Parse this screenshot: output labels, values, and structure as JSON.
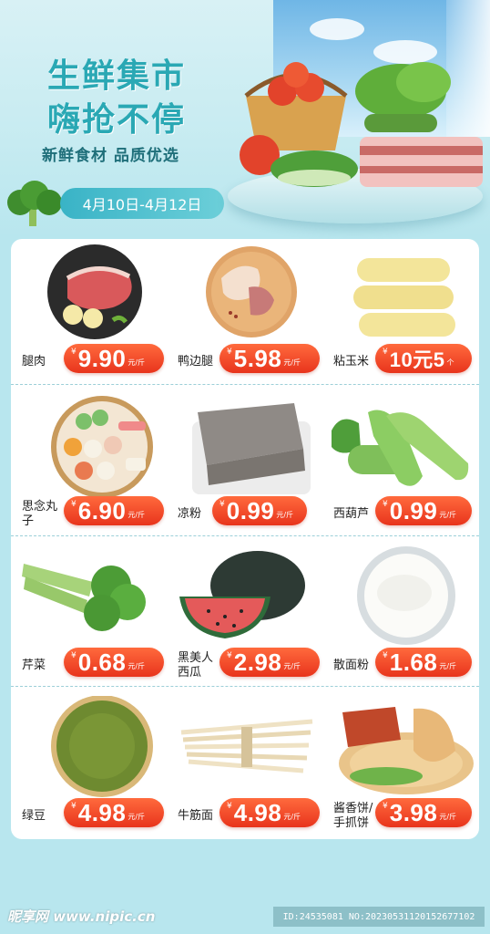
{
  "banner": {
    "title_line1": "生鲜集市",
    "title_line2": "嗨抢不停",
    "subtitle": "新鲜食材  品质优选",
    "date_range": "4月10日-4月12日"
  },
  "colors": {
    "title": "#2aa8b4",
    "price_pill": "#e8341c",
    "background": "#b8e6ee",
    "date_pill": "#39b3c6"
  },
  "products": [
    {
      "name": "腿肉",
      "yen": "¥",
      "price": "9.90",
      "unit": "元/斤",
      "icon": "pork-leg-icon"
    },
    {
      "name": "鸭边腿",
      "yen": "¥",
      "price": "5.98",
      "unit": "元/斤",
      "icon": "duck-leg-icon"
    },
    {
      "name": "粘玉米",
      "yen": "¥",
      "price": "10元5",
      "unit": "个",
      "icon": "corn-icon"
    },
    {
      "name": "思念丸子",
      "yen": "¥",
      "price": "6.90",
      "unit": "元/斤",
      "icon": "meatballs-icon"
    },
    {
      "name": "凉粉",
      "yen": "¥",
      "price": "0.99",
      "unit": "元/斤",
      "icon": "jelly-icon"
    },
    {
      "name": "西葫芦",
      "yen": "¥",
      "price": "0.99",
      "unit": "元/斤",
      "icon": "zucchini-icon"
    },
    {
      "name": "芹菜",
      "yen": "¥",
      "price": "0.68",
      "unit": "元/斤",
      "icon": "celery-icon"
    },
    {
      "name": "黑美人西瓜",
      "yen": "¥",
      "price": "2.98",
      "unit": "元/斤",
      "icon": "watermelon-icon"
    },
    {
      "name": "散面粉",
      "yen": "¥",
      "price": "1.68",
      "unit": "元/斤",
      "icon": "flour-icon"
    },
    {
      "name": "绿豆",
      "yen": "¥",
      "price": "4.98",
      "unit": "元/斤",
      "icon": "mung-bean-icon"
    },
    {
      "name": "牛筋面",
      "yen": "¥",
      "price": "4.98",
      "unit": "元/斤",
      "icon": "noodles-icon"
    },
    {
      "name": "酱香饼/手抓饼",
      "yen": "¥",
      "price": "3.98",
      "unit": "元/斤",
      "icon": "pancake-icon"
    }
  ],
  "footer": {
    "watermark": "昵享网 www.nipic.cn",
    "id_text": "ID:24535081 NO:20230531120152677102"
  }
}
